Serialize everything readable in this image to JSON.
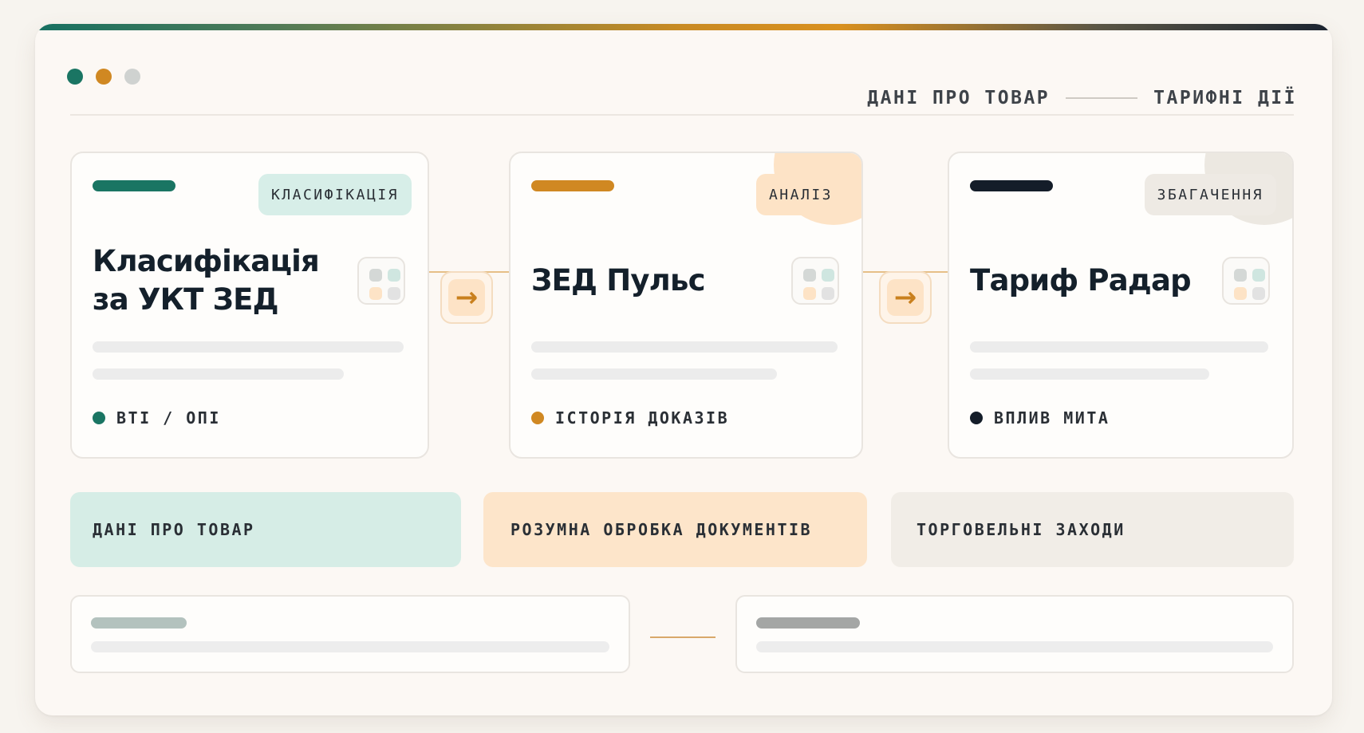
{
  "header": {
    "crumbs": [
      "ДАНІ ПРО ТОВАР",
      "ТАРИФНІ ДІЇ"
    ]
  },
  "colors": {
    "teal": "#1a7563",
    "amber": "#d08822",
    "navy": "#141d29",
    "gray_dot": "#cfd2d0"
  },
  "cards": [
    {
      "badge": "КЛАСИФІКАЦІЯ",
      "title_line1": "Класифікація",
      "title_line2": "за УКТ ЗЕД",
      "footer": "ВТІ / ОПІ",
      "icon": "grid-icon"
    },
    {
      "badge": "АНАЛІЗ",
      "title_line1": "ЗЕД Пульс",
      "footer": "ІСТОРІЯ ДОКАЗІВ",
      "icon": "grid-icon"
    },
    {
      "badge": "ЗБАГАЧЕННЯ",
      "title_line1": "Тариф Радар",
      "footer": "ВПЛИВ МИТА",
      "icon": "grid-icon"
    }
  ],
  "arrows": [
    "arrow-right-icon",
    "arrow-right-icon"
  ],
  "bands": [
    {
      "label": "ДАНІ ПРО ТОВАР"
    },
    {
      "label": "РОЗУМНА ОБРОБКА ДОКУМЕНТІВ"
    },
    {
      "label": "ТОРГОВЕЛЬНІ ЗАХОДИ"
    }
  ]
}
